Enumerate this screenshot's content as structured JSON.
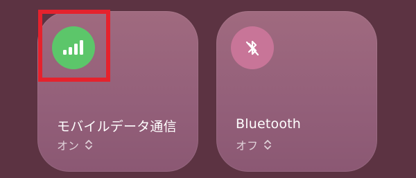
{
  "tiles": [
    {
      "title": "モバイルデータ通信",
      "status": "オン",
      "icon": "signal-bars-icon",
      "state": "on"
    },
    {
      "title": "Bluetooth",
      "status": "オフ",
      "icon": "bluetooth-off-icon",
      "state": "off"
    }
  ],
  "colors": {
    "background": "#5c3342",
    "tile": "#9a6580",
    "on_accent": "#5cc66a",
    "off_accent": "#c87598",
    "highlight": "#e5222d"
  }
}
